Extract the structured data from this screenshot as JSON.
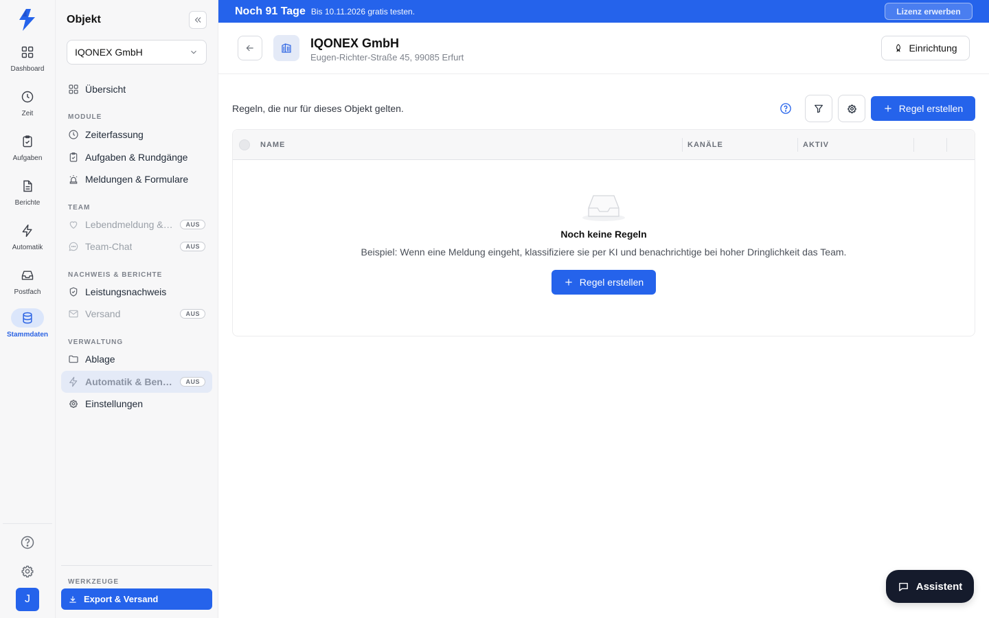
{
  "banner": {
    "days": "Noch 91 Tage",
    "text": "Bis 10.11.2026 gratis testen.",
    "cta": "Lizenz erwerben"
  },
  "rail": {
    "items": [
      {
        "label": "Dashboard",
        "icon": "grid-icon"
      },
      {
        "label": "Zeit",
        "icon": "clock-icon"
      },
      {
        "label": "Aufgaben",
        "icon": "clipboard-check-icon"
      },
      {
        "label": "Berichte",
        "icon": "document-icon"
      },
      {
        "label": "Automatik",
        "icon": "lightning-icon"
      },
      {
        "label": "Postfach",
        "icon": "inbox-icon"
      },
      {
        "label": "Stammdaten",
        "icon": "database-icon",
        "active": true
      }
    ],
    "avatar": "J"
  },
  "panel": {
    "title": "Objekt",
    "selected_object": "IQONEX GmbH",
    "overview": "Übersicht",
    "sections": {
      "module": "MODULE",
      "team": "TEAM",
      "nachweis": "NACHWEIS & BERICHTE",
      "verwaltung": "VERWALTUNG",
      "werkzeuge": "WERKZEUGE"
    },
    "items": {
      "zeiterfassung": "Zeiterfassung",
      "aufgaben": "Aufgaben & Rundgänge",
      "meldungen": "Meldungen & Formulare",
      "lebendmeldung": "Lebendmeldung & …",
      "teamchat": "Team-Chat",
      "leistungsnachweis": "Leistungsnachweis",
      "versand": "Versand",
      "ablage": "Ablage",
      "automatik": "Automatik & Bena…",
      "einstellungen": "Einstellungen",
      "export": "Export & Versand"
    },
    "badge_off": "AUS"
  },
  "header": {
    "title": "IQONEX GmbH",
    "address": "Eugen-Richter-Straße 45, 99085 Erfurt",
    "setup_button": "Einrichtung"
  },
  "content": {
    "intro": "Regeln, die nur für dieses Objekt gelten.",
    "create_button": "Regel erstellen",
    "columns": {
      "name": "NAME",
      "channels": "KANÄLE",
      "active": "AKTIV"
    },
    "empty_title": "Noch keine Regeln",
    "empty_desc": "Beispiel: Wenn eine Meldung eingeht, klassifiziere sie per KI und benachrichtige bei hoher Dringlichkeit das Team.",
    "empty_button": "Regel erstellen"
  },
  "assistant": {
    "label": "Assistent"
  },
  "colors": {
    "primary": "#2563eb",
    "assistant_bg": "#151b2c"
  }
}
